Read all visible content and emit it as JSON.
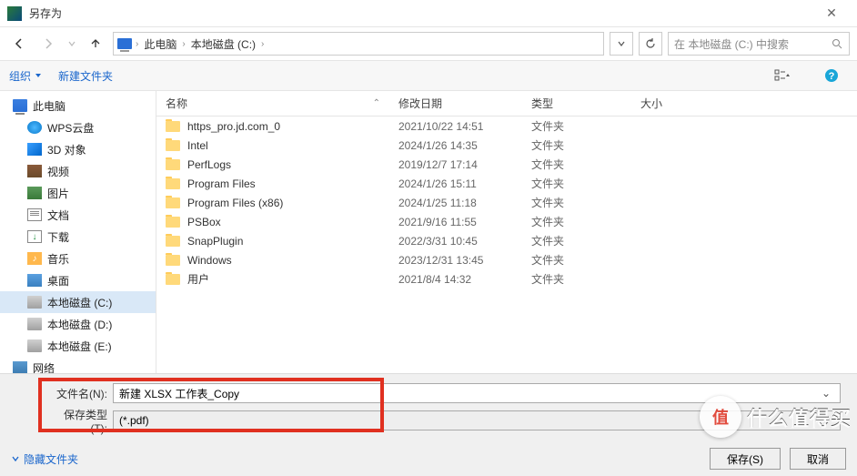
{
  "window": {
    "title": "另存为"
  },
  "nav": {
    "crumbs": [
      "此电脑",
      "本地磁盘 (C:)"
    ],
    "search_placeholder": "在 本地磁盘 (C:) 中搜索"
  },
  "toolbar": {
    "organize": "组织",
    "new_folder": "新建文件夹"
  },
  "tree": {
    "items": [
      {
        "label": "此电脑",
        "icon": "ico-pc",
        "child": false,
        "selected": false
      },
      {
        "label": "WPS云盘",
        "icon": "ico-wps",
        "child": true,
        "selected": false
      },
      {
        "label": "3D 对象",
        "icon": "ico-3d",
        "child": true,
        "selected": false
      },
      {
        "label": "视频",
        "icon": "ico-video",
        "child": true,
        "selected": false
      },
      {
        "label": "图片",
        "icon": "ico-pic",
        "child": true,
        "selected": false
      },
      {
        "label": "文档",
        "icon": "ico-doc",
        "child": true,
        "selected": false
      },
      {
        "label": "下载",
        "icon": "ico-dl",
        "child": true,
        "selected": false
      },
      {
        "label": "音乐",
        "icon": "ico-music",
        "child": true,
        "selected": false
      },
      {
        "label": "桌面",
        "icon": "ico-desk",
        "child": true,
        "selected": false
      },
      {
        "label": "本地磁盘 (C:)",
        "icon": "ico-disk",
        "child": true,
        "selected": true
      },
      {
        "label": "本地磁盘 (D:)",
        "icon": "ico-disk",
        "child": true,
        "selected": false
      },
      {
        "label": "本地磁盘 (E:)",
        "icon": "ico-disk",
        "child": true,
        "selected": false
      },
      {
        "label": "网络",
        "icon": "ico-net",
        "child": false,
        "selected": false
      }
    ]
  },
  "columns": {
    "name": "名称",
    "date": "修改日期",
    "type": "类型",
    "size": "大小"
  },
  "files": [
    {
      "name": "https_pro.jd.com_0",
      "date": "2021/10/22 14:51",
      "type": "文件夹"
    },
    {
      "name": "Intel",
      "date": "2024/1/26 14:35",
      "type": "文件夹"
    },
    {
      "name": "PerfLogs",
      "date": "2019/12/7 17:14",
      "type": "文件夹"
    },
    {
      "name": "Program Files",
      "date": "2024/1/26 15:11",
      "type": "文件夹"
    },
    {
      "name": "Program Files (x86)",
      "date": "2024/1/25 11:18",
      "type": "文件夹"
    },
    {
      "name": "PSBox",
      "date": "2021/9/16 11:55",
      "type": "文件夹"
    },
    {
      "name": "SnapPlugin",
      "date": "2022/3/31 10:45",
      "type": "文件夹"
    },
    {
      "name": "Windows",
      "date": "2023/12/31 13:45",
      "type": "文件夹"
    },
    {
      "name": "用户",
      "date": "2021/8/4 14:32",
      "type": "文件夹"
    }
  ],
  "form": {
    "filename_label": "文件名(N):",
    "filename_value": "新建 XLSX 工作表_Copy",
    "filetype_label": "保存类型(T):",
    "filetype_value": "(*.pdf)"
  },
  "footer": {
    "hide_folders": "隐藏文件夹",
    "save": "保存(S)",
    "cancel": "取消"
  },
  "watermark": {
    "badge": "值",
    "text": "什么值得买"
  }
}
